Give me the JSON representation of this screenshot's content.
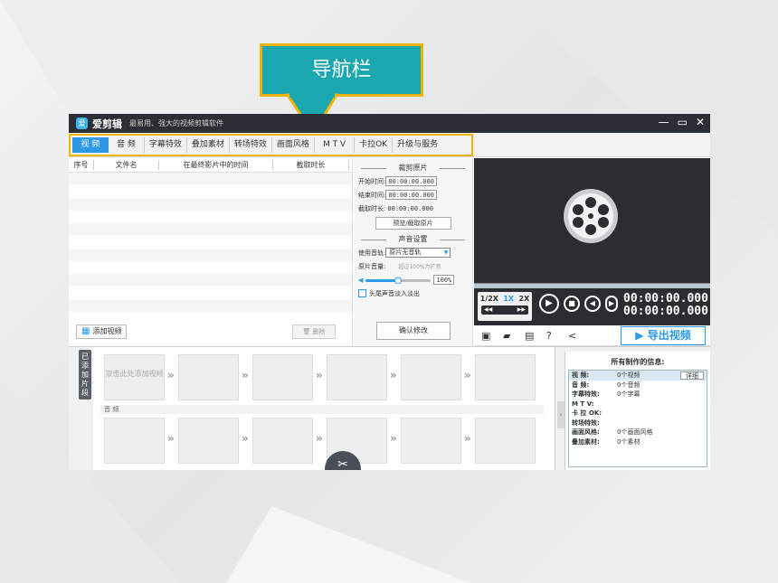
{
  "callout": {
    "label": "导航栏"
  },
  "app": {
    "name": "爱剪辑",
    "slogan": "最易用、强大的视频剪辑软件",
    "logo_char": "爱"
  },
  "nav": {
    "tabs": [
      "视 频",
      "音 频",
      "字幕特效",
      "叠加素材",
      "转场特效",
      "画面风格",
      "M T V",
      "卡拉OK",
      "升级与服务"
    ]
  },
  "list": {
    "headers": [
      "序号",
      "文件名",
      "在最终影片中的时间",
      "截取时长"
    ],
    "add_label": "添加视频",
    "delete_label": "删除"
  },
  "cut": {
    "section_title": "裁剪原片",
    "start_label": "开始时间:",
    "start_value": "00:00:00.000",
    "end_label": "结束时间:",
    "end_value": "00:00:00.000",
    "duration_label": "截取时长:",
    "duration_value": "00:00:00.000",
    "preview_btn": "预览/截取原片",
    "audio_section": "声音设置",
    "track_label": "使用音轨:",
    "track_value": "原片无音轨",
    "volume_label": "原片音量:",
    "volume_hint": "超过100%为扩音",
    "volume_value": "100%",
    "volume_level": 0.5,
    "fade_label": "头尾声音淡入淡出",
    "confirm_btn": "确认修改"
  },
  "player": {
    "speeds": [
      "1/2X",
      "1X",
      "2X"
    ],
    "selected_speed": "1X",
    "timecode_current": "00:00:00.000",
    "timecode_total": "00:00:00.000",
    "export_label": "导出视频"
  },
  "timeline": {
    "side_tab": "已添加片段",
    "first_slot_text": "双击此处添加视频",
    "audio_label": "音 频"
  },
  "info": {
    "title": "所有制作的信息:",
    "detail_btn": "详细",
    "rows": [
      {
        "k": "视    频:",
        "v": "0个视频"
      },
      {
        "k": "音    频:",
        "v": "0个音频"
      },
      {
        "k": "字幕特效:",
        "v": "0个字幕"
      },
      {
        "k": "M  T  V:",
        "v": ""
      },
      {
        "k": "卡 拉 OK:",
        "v": ""
      },
      {
        "k": "转场特效:",
        "v": ""
      },
      {
        "k": "画面风格:",
        "v": "0个画面风格"
      },
      {
        "k": "叠加素材:",
        "v": "0个素材"
      }
    ]
  },
  "colors": {
    "accent": "#2d9ae8",
    "callout": "#1aa7b0",
    "highlight": "#f0b400",
    "dark": "#2a2e33"
  }
}
